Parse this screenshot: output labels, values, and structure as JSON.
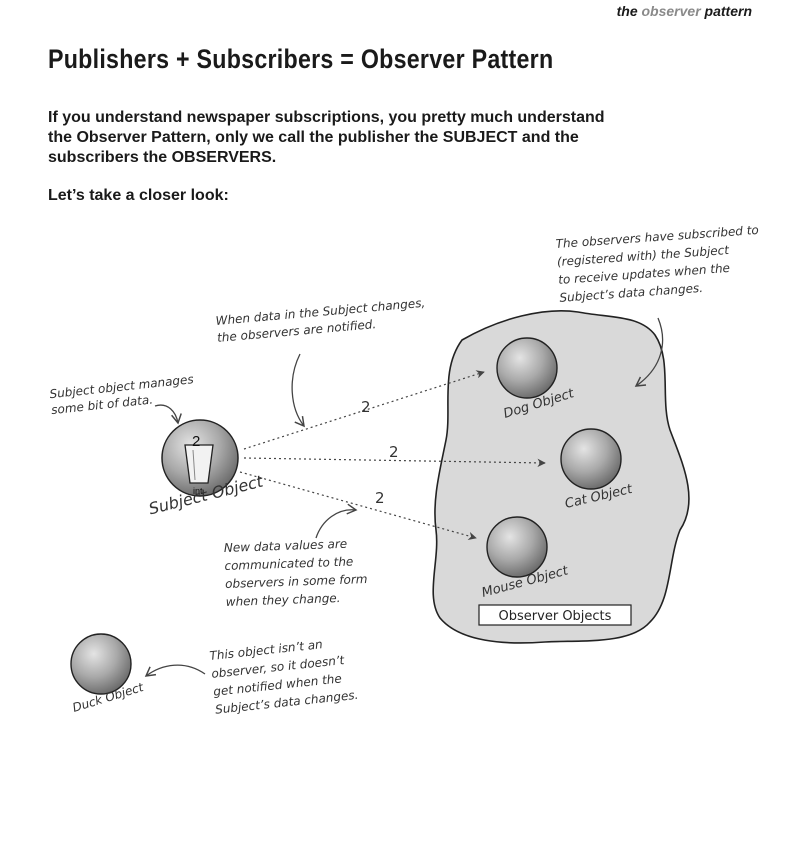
{
  "header": {
    "running_head_prefix": "the ",
    "running_head_highlight": "observer",
    "running_head_suffix": " pattern"
  },
  "title": "Publishers + Subscribers = Observer Pattern",
  "intro": "If you understand newspaper subscriptions, you pretty much understand the Observer Pattern, only we call the publisher the SUBJECT and the subscribers the OBSERVERS.",
  "lead": "Let’s take a closer look:",
  "diagram": {
    "subject": {
      "label": "Subject Object",
      "value": "2",
      "type_label": "int"
    },
    "observers": [
      {
        "label": "Dog Object"
      },
      {
        "label": "Cat Object"
      },
      {
        "label": "Mouse Object"
      }
    ],
    "message_values": [
      "2",
      "2",
      "2"
    ],
    "duck": {
      "label": "Duck Object"
    },
    "group_label": "Observer Objects",
    "notes": {
      "subject_manages": [
        "Subject object manages",
        "some bit of data."
      ],
      "data_changes": [
        "When data in the Subject changes,",
        "the observers are notified."
      ],
      "observers_subscribed": [
        "The observers have subscribed to",
        "(registered with) the Subject",
        "to receive updates when the",
        "Subject’s data changes."
      ],
      "new_values": [
        "New data values are",
        "communicated to the",
        "observers in some form",
        "when they change."
      ],
      "not_observer": [
        "This object isn’t an",
        "observer, so it doesn’t",
        "get notified when the",
        "Subject’s data changes."
      ]
    }
  }
}
